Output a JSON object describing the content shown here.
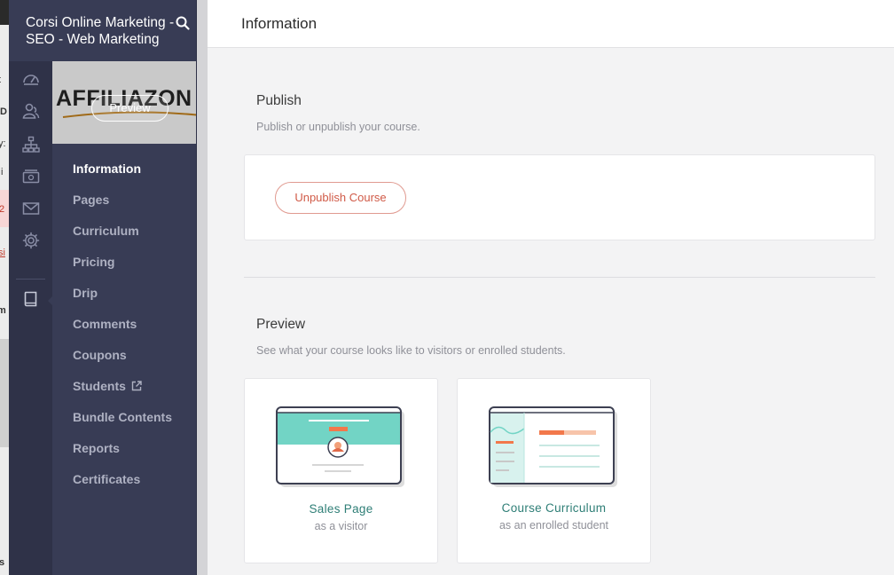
{
  "school": {
    "title": "Corsi Online Marketing - SEO - Web Marketing"
  },
  "course": {
    "thumbnail_text": "AFFILIAZON",
    "preview_label": "Preview"
  },
  "nav": {
    "items": [
      {
        "label": "Information",
        "active": true
      },
      {
        "label": "Pages"
      },
      {
        "label": "Curriculum"
      },
      {
        "label": "Pricing"
      },
      {
        "label": "Drip"
      },
      {
        "label": "Comments"
      },
      {
        "label": "Coupons"
      },
      {
        "label": "Students",
        "icon": "external-link-icon"
      },
      {
        "label": "Bundle Contents"
      },
      {
        "label": "Reports"
      },
      {
        "label": "Certificates"
      }
    ]
  },
  "rail": {
    "icons": [
      "dashboard-icon",
      "users-icon",
      "sitemap-icon",
      "money-icon",
      "mail-icon",
      "gear-icon",
      "book-icon"
    ]
  },
  "header": {
    "title": "Information"
  },
  "publish": {
    "title": "Publish",
    "description": "Publish or unpublish your course.",
    "button_label": "Unpublish Course"
  },
  "preview": {
    "title": "Preview",
    "description": "See what your course looks like to visitors or enrolled students.",
    "cards": [
      {
        "title": "Sales Page",
        "subtitle": "as a visitor"
      },
      {
        "title": "Course Curriculum",
        "subtitle": "as an enrolled student"
      }
    ]
  },
  "background_fragments": [
    "t",
    "D",
    "y:",
    "i",
    "2",
    "si",
    "m",
    "s"
  ],
  "colors": {
    "sidebar": "#383c55",
    "rail": "#2f3248",
    "accent_teal": "#72d4c5",
    "accent_orange": "#f2784b",
    "danger": "#d05a47",
    "link_teal": "#2e7e76"
  }
}
